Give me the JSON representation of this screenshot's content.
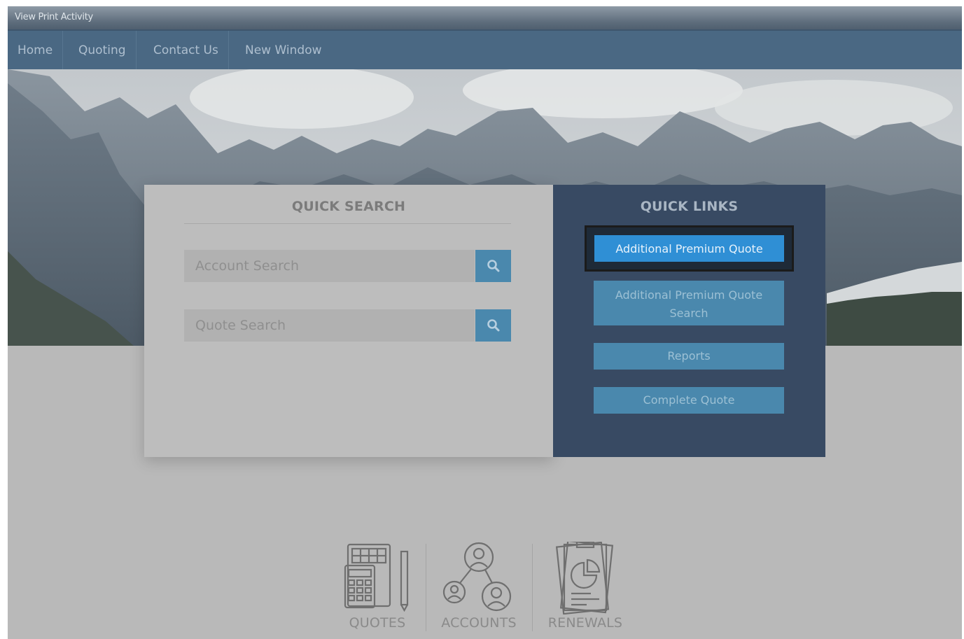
{
  "topbar": {
    "title": "View Print Activity"
  },
  "nav": {
    "items": [
      {
        "label": "Home",
        "name": "nav-home"
      },
      {
        "label": "Quoting",
        "name": "nav-quoting"
      },
      {
        "label": "Contact Us",
        "name": "nav-contact-us"
      },
      {
        "label": "New Window",
        "name": "nav-new-window"
      }
    ]
  },
  "quick_search": {
    "title": "QUICK SEARCH",
    "account_placeholder": "Account Search",
    "quote_placeholder": "Quote Search",
    "search_icon": "search-icon"
  },
  "quick_links": {
    "title": "QUICK LINKS",
    "primary": "Additional Premium Quote",
    "search_line1": "Additional Premium Quote",
    "search_line2": "Search",
    "reports": "Reports",
    "complete": "Complete Quote"
  },
  "tiles": {
    "quotes": {
      "label": "QUOTES",
      "icon": "calculator-icon"
    },
    "accounts": {
      "label": "ACCOUNTS",
      "icon": "people-network-icon"
    },
    "renewals": {
      "label": "RENEWALS",
      "icon": "documents-chart-icon"
    }
  },
  "colors": {
    "nav_bg": "#4a6883",
    "links_panel_bg": "#384a63",
    "button_bg": "#4a88ad",
    "primary_button_bg": "#2f8fd5",
    "overlay_gray": "#b9b9b9"
  }
}
